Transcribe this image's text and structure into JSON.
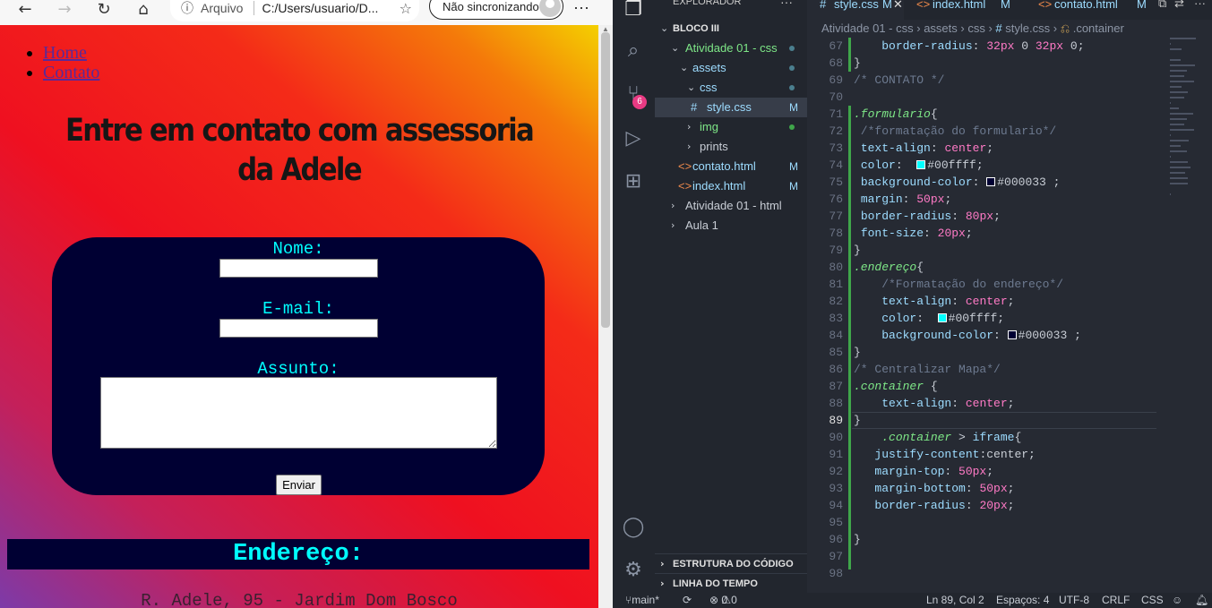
{
  "browser": {
    "address_protocol": "Arquivo",
    "address_url": "C:/Users/usuario/D...",
    "sync_label": "Não sincronizando"
  },
  "page": {
    "nav": [
      "Home",
      "Contato"
    ],
    "title": "Entre em contato com assessoria da Adele",
    "form": {
      "name_label": "Nome:",
      "email_label": "E-mail:",
      "subject_label": "Assunto:",
      "name_value": "",
      "email_value": "",
      "subject_value": "",
      "submit_label": "Enviar"
    },
    "address_heading": "Endereço:",
    "address_text": "R. Adele, 95 - Jardim Dom Bosco",
    "colors": {
      "form_bg": "#000033",
      "form_text": "#00ffff"
    }
  },
  "vscode": {
    "explorer_title": "EXPLORADOR",
    "tree": [
      {
        "label": "BLOCO III"
      },
      {
        "label": "Atividade 01 - css"
      },
      {
        "label": "assets"
      },
      {
        "label": "css"
      },
      {
        "label": "style.css",
        "status": "M"
      },
      {
        "label": "img"
      },
      {
        "label": "prints"
      },
      {
        "label": "contato.html",
        "status": "M"
      },
      {
        "label": "index.html",
        "status": "M"
      },
      {
        "label": "Atividade 01 - html"
      },
      {
        "label": "Aula 1"
      }
    ],
    "outline": "ESTRUTURA DO CÓDIGO",
    "timeline": "LINHA DO TEMPO",
    "scm_badge": "6",
    "tabs": [
      {
        "label": "style.css",
        "status": "M"
      },
      {
        "label": "index.html",
        "status": "M"
      },
      {
        "label": "contato.html",
        "status": "M"
      }
    ],
    "breadcrumb": [
      "Atividade 01 - css",
      "assets",
      "css",
      "style.css",
      ".container"
    ],
    "code": [
      {
        "n": "67",
        "t": "    border-radius: 32px 0 32px 0;"
      },
      {
        "n": "68",
        "t": "}"
      },
      {
        "n": "69",
        "t": "/* CONTATO */"
      },
      {
        "n": "70",
        "t": ""
      },
      {
        "n": "71",
        "t": ".formulario{"
      },
      {
        "n": "72",
        "t": " /*formatação do formulario*/"
      },
      {
        "n": "73",
        "t": " text-align: center;"
      },
      {
        "n": "74",
        "t": " color:  #00ffff;"
      },
      {
        "n": "75",
        "t": " background-color: #000033 ;"
      },
      {
        "n": "76",
        "t": " margin: 50px;"
      },
      {
        "n": "77",
        "t": " border-radius: 80px;"
      },
      {
        "n": "78",
        "t": " font-size: 20px;"
      },
      {
        "n": "79",
        "t": "}"
      },
      {
        "n": "80",
        "t": ".endereço{"
      },
      {
        "n": "81",
        "t": "    /*Formatação do endereço*/"
      },
      {
        "n": "82",
        "t": "    text-align: center;"
      },
      {
        "n": "83",
        "t": "    color:  #00ffff;"
      },
      {
        "n": "84",
        "t": "    background-color: #000033 ;"
      },
      {
        "n": "85",
        "t": "}"
      },
      {
        "n": "86",
        "t": "/* Centralizar Mapa*/"
      },
      {
        "n": "87",
        "t": ".container {"
      },
      {
        "n": "88",
        "t": "    text-align: center;"
      },
      {
        "n": "89",
        "t": "}"
      },
      {
        "n": "90",
        "t": "    .container > iframe{"
      },
      {
        "n": "91",
        "t": "   justify-content:center;"
      },
      {
        "n": "92",
        "t": "   margin-top: 50px;"
      },
      {
        "n": "93",
        "t": "   margin-bottom: 50px;"
      },
      {
        "n": "94",
        "t": "   border-radius: 20px;"
      },
      {
        "n": "95",
        "t": ""
      },
      {
        "n": "96",
        "t": "}"
      },
      {
        "n": "97",
        "t": ""
      },
      {
        "n": "98",
        "t": ""
      }
    ],
    "status": {
      "branch": "main*",
      "problems": "0",
      "warnings": "0",
      "position": "Ln 89, Col 2",
      "spaces": "Espaços: 4",
      "encoding": "UTF-8",
      "eol": "CRLF",
      "language": "CSS"
    },
    "colors": {
      "accent_green": "#7ee787",
      "value_pink": "#ff7ac6",
      "property_blue": "#9ddcff"
    }
  }
}
